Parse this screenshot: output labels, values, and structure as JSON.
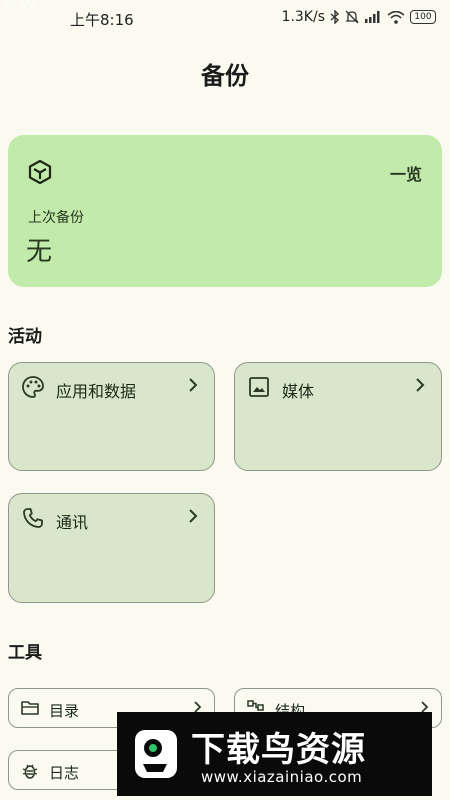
{
  "status_bar": {
    "time": "上午8:16",
    "network_speed": "1.3K/s",
    "battery": "100",
    "icons": [
      "bluetooth-icon",
      "mute-icon",
      "signal-icon",
      "wifi-icon",
      "battery-icon"
    ]
  },
  "page": {
    "title": "备份"
  },
  "summary": {
    "overview_label": "一览",
    "last_backup_label": "上次备份",
    "last_backup_value": "无",
    "icon": "cube-icon"
  },
  "activity": {
    "heading": "活动",
    "tiles": [
      {
        "label": "应用和数据",
        "icon": "palette-icon"
      },
      {
        "label": "媒体",
        "icon": "image-icon"
      },
      {
        "label": "通讯",
        "icon": "phone-icon"
      }
    ]
  },
  "tools": {
    "heading": "工具",
    "items": [
      {
        "label": "目录",
        "icon": "folder-icon"
      },
      {
        "label": "结构",
        "icon": "structure-icon"
      },
      {
        "label": "日志",
        "icon": "bug-icon"
      }
    ]
  },
  "watermark": {
    "brand": "下载鸟资源",
    "url": "www.xiazainiao.com"
  },
  "colors": {
    "background": "#fafaf0",
    "summary_card": "#c2eaaa",
    "tile": "#d9e6cc",
    "tile_border": "#8d9888"
  }
}
